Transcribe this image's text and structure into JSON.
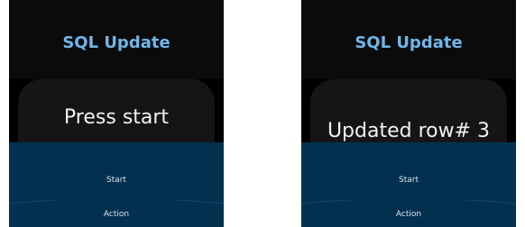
{
  "screens": [
    {
      "title": "SQL Update",
      "message": "Press start",
      "buttons": {
        "start": "Start",
        "action": "Action"
      }
    },
    {
      "title": "SQL Update",
      "message": "Updated row# 3",
      "buttons": {
        "start": "Start",
        "action": "Action"
      }
    }
  ],
  "colors": {
    "title": "#6fb7ea",
    "bottom_panel": "#04304f",
    "background": "#000000"
  }
}
